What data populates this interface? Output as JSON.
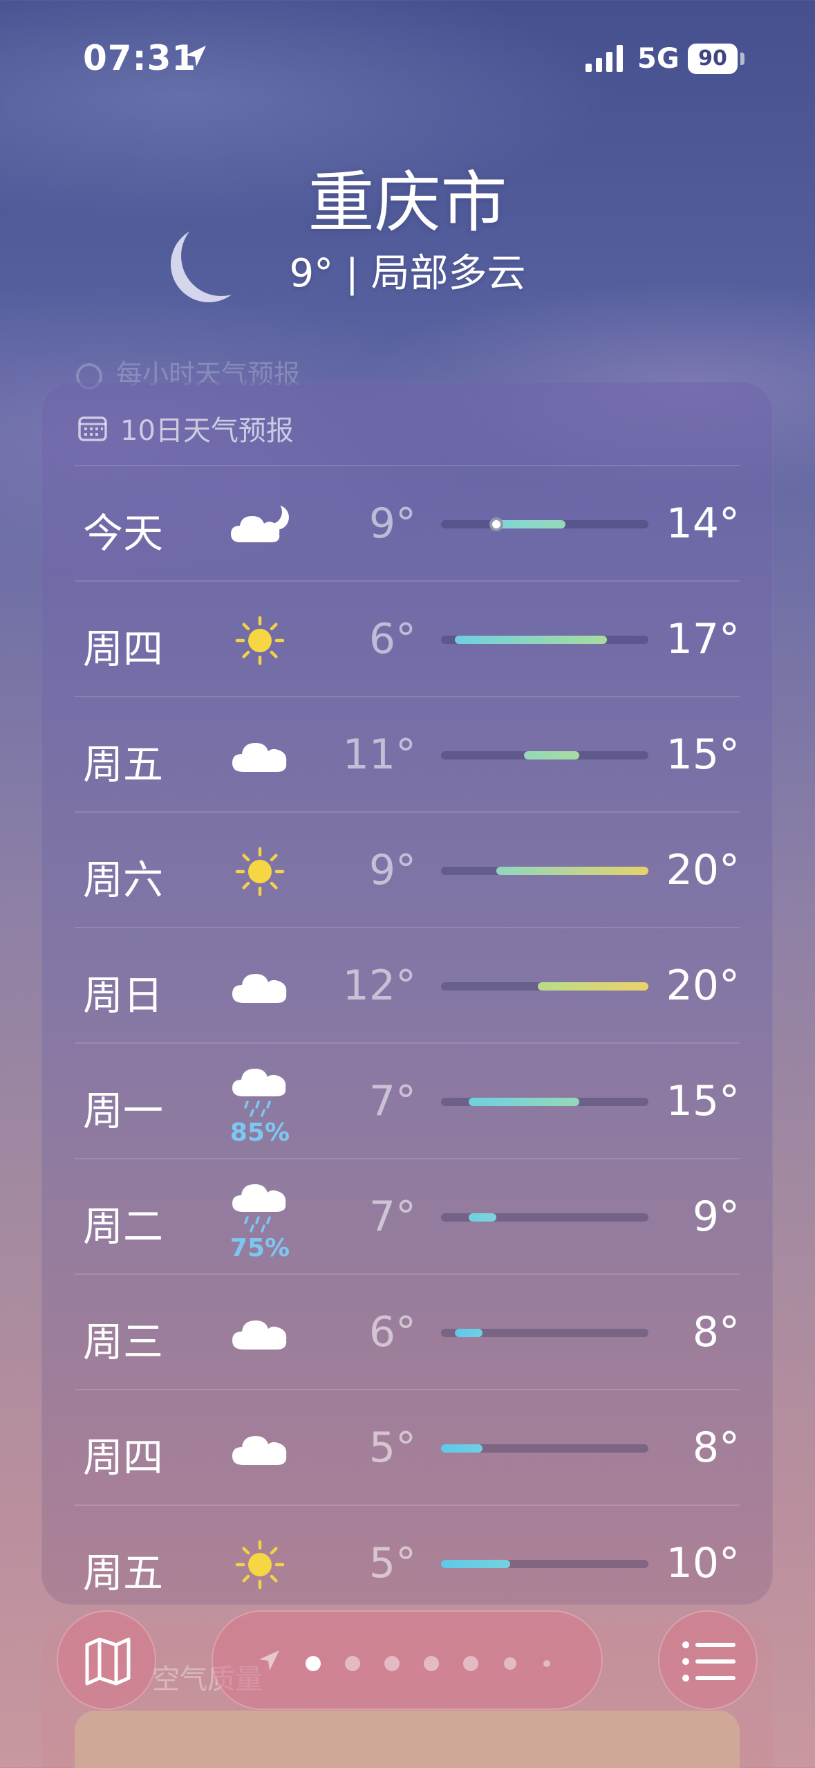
{
  "status_bar": {
    "time": "07:31",
    "network": "5G",
    "battery": "90"
  },
  "header": {
    "city": "重庆市",
    "conditions": "9° | 局部多云"
  },
  "hourly_section": {
    "label": "每小时天气预报"
  },
  "forecast": {
    "title": "10日天气预报",
    "range_min": 5,
    "range_max": 20,
    "days": [
      {
        "day": "今天",
        "icon": "partly-cloudy-night-icon",
        "precip": "",
        "low": "9°",
        "high": "14°",
        "lo_val": 9,
        "hi_val": 14,
        "current": 9,
        "colors": [
          "#7fd6d6",
          "#95d8b8"
        ]
      },
      {
        "day": "周四",
        "icon": "sun-icon",
        "precip": "",
        "low": "6°",
        "high": "17°",
        "lo_val": 6,
        "hi_val": 17,
        "colors": [
          "#6fd0e0",
          "#a8dc9c"
        ]
      },
      {
        "day": "周五",
        "icon": "cloud-icon",
        "precip": "",
        "low": "11°",
        "high": "15°",
        "lo_val": 11,
        "hi_val": 15,
        "colors": [
          "#95d8b8",
          "#a6dca0"
        ]
      },
      {
        "day": "周六",
        "icon": "sun-icon",
        "precip": "",
        "low": "9°",
        "high": "20°",
        "lo_val": 9,
        "hi_val": 20,
        "colors": [
          "#8fd6c0",
          "#e6d26a"
        ]
      },
      {
        "day": "周日",
        "icon": "cloud-icon",
        "precip": "",
        "low": "12°",
        "high": "20°",
        "lo_val": 12,
        "hi_val": 20,
        "colors": [
          "#b8dc8a",
          "#ecd26a"
        ]
      },
      {
        "day": "周一",
        "icon": "rain-icon",
        "precip": "85%",
        "low": "7°",
        "high": "15°",
        "lo_val": 7,
        "hi_val": 15,
        "colors": [
          "#6fd0e0",
          "#95d8b8"
        ]
      },
      {
        "day": "周二",
        "icon": "rain-icon",
        "precip": "75%",
        "low": "7°",
        "high": "9°",
        "lo_val": 7,
        "hi_val": 9,
        "colors": [
          "#6fd0e0",
          "#7dd4d8"
        ]
      },
      {
        "day": "周三",
        "icon": "cloud-icon",
        "precip": "",
        "low": "6°",
        "high": "8°",
        "lo_val": 6,
        "hi_val": 8,
        "colors": [
          "#5fc8ea",
          "#6fd0e0"
        ]
      },
      {
        "day": "周四",
        "icon": "cloud-icon",
        "precip": "",
        "low": "5°",
        "high": "8°",
        "lo_val": 5,
        "hi_val": 8,
        "colors": [
          "#5fc8ea",
          "#6fd0e0"
        ]
      },
      {
        "day": "周五",
        "icon": "sun-icon",
        "precip": "",
        "low": "5°",
        "high": "10°",
        "lo_val": 5,
        "hi_val": 10,
        "colors": [
          "#5fc8ea",
          "#74d2dc"
        ]
      }
    ]
  },
  "bottom_section": {
    "label": "空气质量"
  },
  "page_control": {
    "count": 7,
    "active": 0
  }
}
